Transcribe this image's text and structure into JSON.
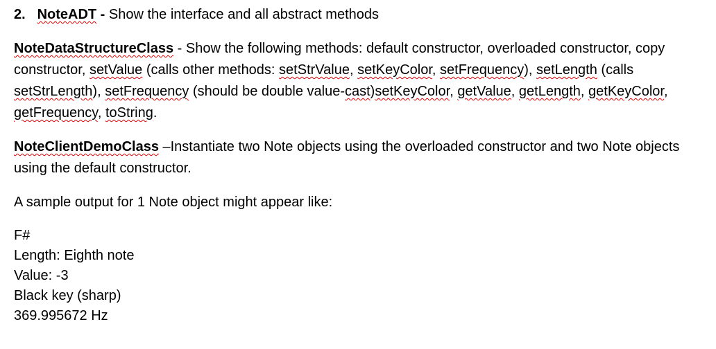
{
  "item": {
    "number": "2.",
    "title": "NoteADT",
    "desc_prefix": " -",
    "desc": " Show the interface and all abstract methods"
  },
  "dsc": {
    "title": "NoteDataStructureClass",
    "seg1": " - Show the following methods: default constructor, overloaded constructor, copy constructor, ",
    "m_setValue": "setValue",
    "seg2": " (calls other methods: ",
    "m_setStrValue": "setStrValue",
    "seg3": ", ",
    "m_setKeyColor1": "setKeyColor",
    "seg4": ", ",
    "m_setFrequency1": "setFrequency",
    "seg5": "), ",
    "m_setLength": "setLength",
    "seg6": " (calls ",
    "m_setStrLength": "setStrLength",
    "seg7": "), ",
    "m_setFrequency2": "setFrequency",
    "seg8": " (should be double value-",
    "m_cast": "cast",
    "seg9": ")",
    "m_setKeyColor2": "setKeyColor",
    "seg10": ", ",
    "m_getValue": "getValue",
    "seg11": ", ",
    "m_getLength": "getLength",
    "seg12": ", ",
    "m_getKeyColor": "getKeyColor",
    "seg13": ", ",
    "m_getFrequency": "getFrequency",
    "seg14": ", ",
    "m_toString": "toString",
    "seg15": "."
  },
  "client": {
    "title": "NoteClientDemoClass",
    "body": " –Instantiate two Note objects using the overloaded constructor and two Note objects using the default constructor."
  },
  "sample_label": "A sample output for 1 Note object might appear like:",
  "sample": {
    "line1": "F#",
    "line2": "Length: Eighth note",
    "line3": "Value: -3",
    "line4": "Black key (sharp)",
    "line5": "369.995672 Hz"
  }
}
